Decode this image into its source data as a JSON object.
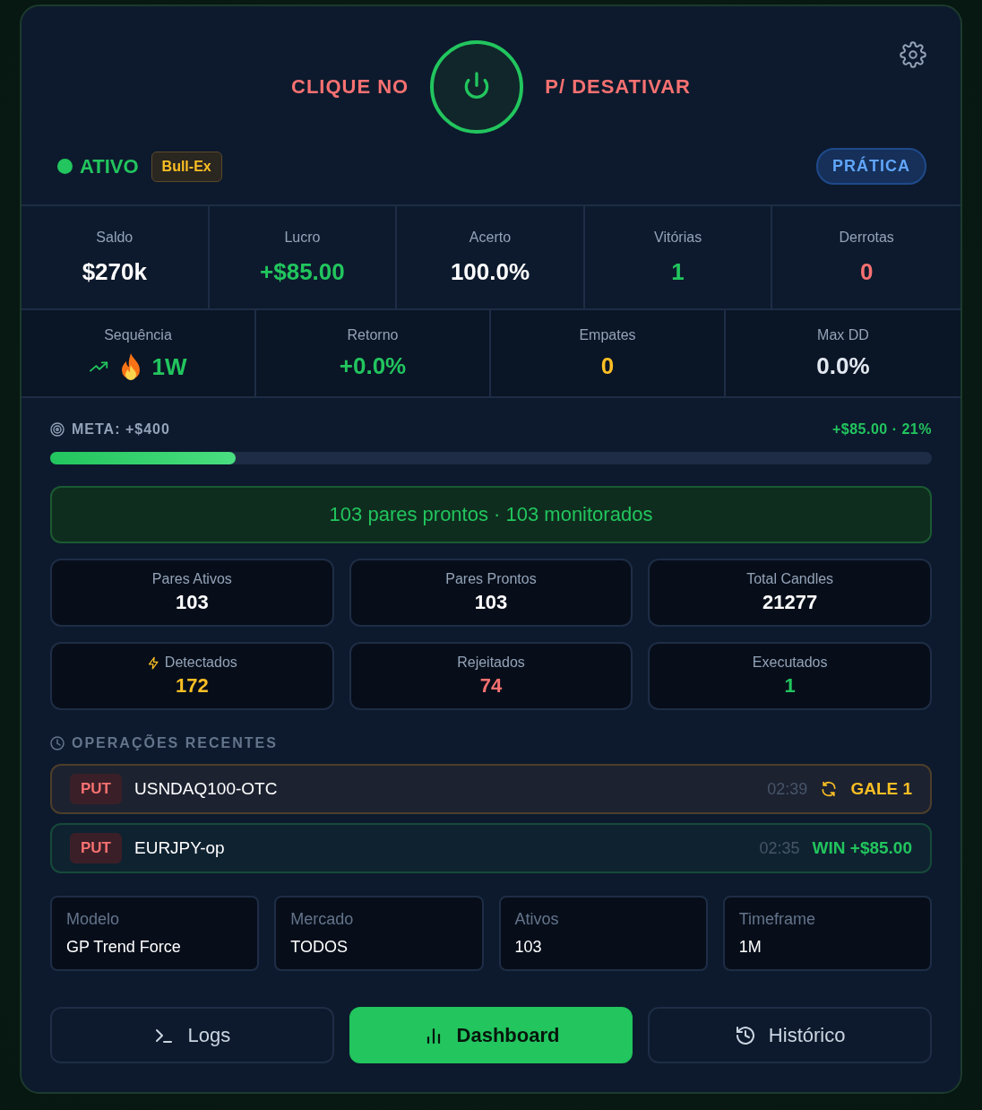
{
  "header": {
    "left_text": "CLIQUE NO",
    "right_text": "P/ DESATIVAR"
  },
  "status": {
    "label": "ATIVO",
    "active": true,
    "broker": "Bull-Ex",
    "mode": "PRÁTICA"
  },
  "stats_row_1": [
    {
      "label": "Saldo",
      "value": "$270k",
      "color": "#ffffff"
    },
    {
      "label": "Lucro",
      "value": "+$85.00",
      "color": "#22c55e"
    },
    {
      "label": "Acerto",
      "value": "100.0%",
      "color": "#ffffff"
    },
    {
      "label": "Vitórias",
      "value": "1",
      "color": "#22c55e"
    },
    {
      "label": "Derrotas",
      "value": "0",
      "color": "#f87171"
    }
  ],
  "stats_row_2": [
    {
      "label": "Sequência",
      "value": "1W",
      "color": "#22c55e",
      "kind": "streak"
    },
    {
      "label": "Retorno",
      "value": "+0.0%",
      "color": "#22c55e",
      "kind": "plain"
    },
    {
      "label": "Empates",
      "value": "0",
      "color": "#fbbf24",
      "kind": "plain"
    },
    {
      "label": "Max DD",
      "value": "0.0%",
      "color": "#e2e8f0",
      "kind": "plain"
    }
  ],
  "goal": {
    "label": "META: +$400",
    "progress_text": "+$85.00 · 21%",
    "level": 0.21
  },
  "banner": "103 pares prontos · 103 monitorados",
  "counters": [
    {
      "label": "Pares Ativos",
      "value": "103",
      "color": "#ffffff",
      "kind": "plain"
    },
    {
      "label": "Pares Prontos",
      "value": "103",
      "color": "#ffffff",
      "kind": "plain"
    },
    {
      "label": "Total Candles",
      "value": "21277",
      "color": "#ffffff",
      "kind": "plain"
    },
    {
      "label": "Detectados",
      "value": "172",
      "color": "#fbbf24",
      "kind": "bolt"
    },
    {
      "label": "Rejeitados",
      "value": "74",
      "color": "#f87171",
      "kind": "plain"
    },
    {
      "label": "Executados",
      "value": "1",
      "color": "#22c55e",
      "kind": "plain"
    }
  ],
  "recent_operations": {
    "title": "OPERAÇÕES RECENTES",
    "items": [
      {
        "direction": "PUT",
        "pair": "USNDAQ100-OTC",
        "time": "02:39",
        "result": "GALE 1",
        "kind": "gale"
      },
      {
        "direction": "PUT",
        "pair": "EURJPY-op",
        "time": "02:35",
        "result": "WIN +$85.00",
        "kind": "win"
      }
    ]
  },
  "settings": [
    {
      "label": "Modelo",
      "value": "GP Trend Force"
    },
    {
      "label": "Mercado",
      "value": "TODOS"
    },
    {
      "label": "Ativos",
      "value": "103"
    },
    {
      "label": "Timeframe",
      "value": "1M"
    }
  ],
  "nav": [
    {
      "label": "Logs",
      "kind": "terminal",
      "selected": false
    },
    {
      "label": "Dashboard",
      "kind": "chart",
      "selected": true
    },
    {
      "label": "Histórico",
      "kind": "history",
      "selected": false
    }
  ]
}
